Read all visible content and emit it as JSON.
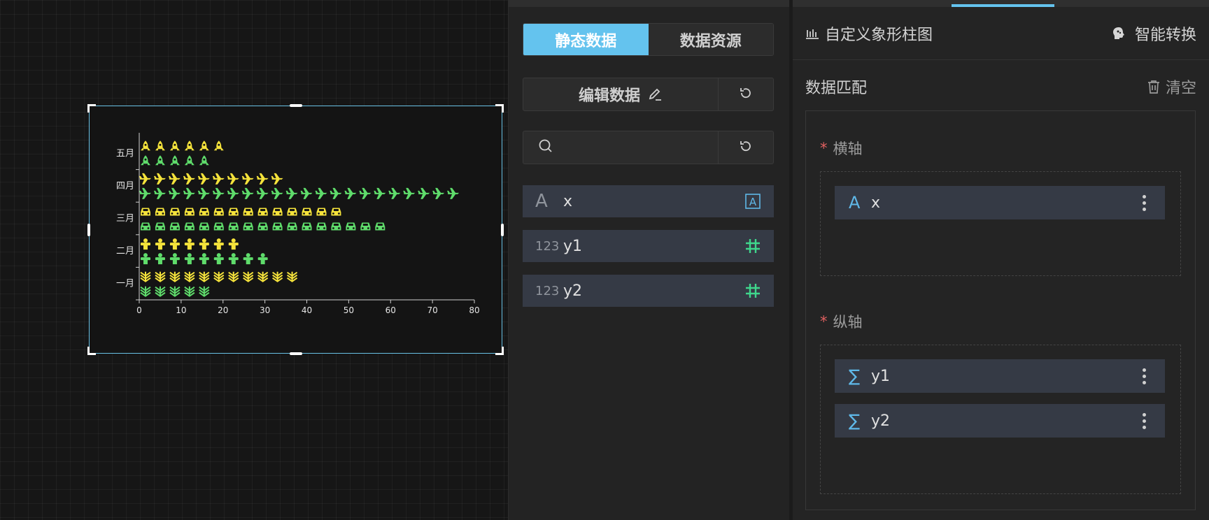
{
  "chart_data": {
    "type": "bar",
    "categories": [
      "一月",
      "二月",
      "三月",
      "四月",
      "五月"
    ],
    "series": [
      {
        "name": "y1",
        "values": [
          37,
          23,
          47,
          33,
          20
        ],
        "symbol": "wheat-icon",
        "color": "#f5e33b"
      },
      {
        "name": "y2",
        "values": [
          17,
          30,
          58,
          76,
          17
        ],
        "symbol": "wheat-icon",
        "color": "#5fdc6b"
      }
    ],
    "symbols_by_category": [
      "wheat-icon",
      "person-icon",
      "car-icon",
      "plane-icon",
      "rocket-icon"
    ],
    "xticks": [
      "0",
      "10",
      "20",
      "30",
      "40",
      "50",
      "60",
      "70",
      "80"
    ],
    "xlim": [
      0,
      80
    ],
    "orientation": "horizontal",
    "grid": false,
    "title": ""
  },
  "data_panel": {
    "tabs": [
      {
        "label": "静态数据",
        "active": true
      },
      {
        "label": "数据资源",
        "active": false
      }
    ],
    "edit_label": "编辑数据",
    "search_placeholder": "",
    "fields": [
      {
        "type_label": "A",
        "name": "x",
        "badge": "text-type-icon"
      },
      {
        "type_label": "123",
        "name": "y1",
        "badge": "number-type-icon"
      },
      {
        "type_label": "123",
        "name": "y2",
        "badge": "number-type-icon"
      }
    ]
  },
  "config_panel": {
    "title": "自定义象形柱图",
    "smart_label": "智能转换",
    "match_title": "数据匹配",
    "clear_label": "清空",
    "x_axis_label": "横轴",
    "y_axis_label": "纵轴",
    "required_mark": "*",
    "x_fields": [
      {
        "icon": "A",
        "name": "x"
      }
    ],
    "y_fields": [
      {
        "icon": "∑",
        "name": "y1"
      },
      {
        "icon": "∑",
        "name": "y2"
      }
    ]
  },
  "colors": {
    "accent": "#64c3ee",
    "chip_bg": "#353a45",
    "series_yellow": "#f5e33b",
    "series_green": "#5fdc6b",
    "number_badge": "#3fd68c"
  }
}
